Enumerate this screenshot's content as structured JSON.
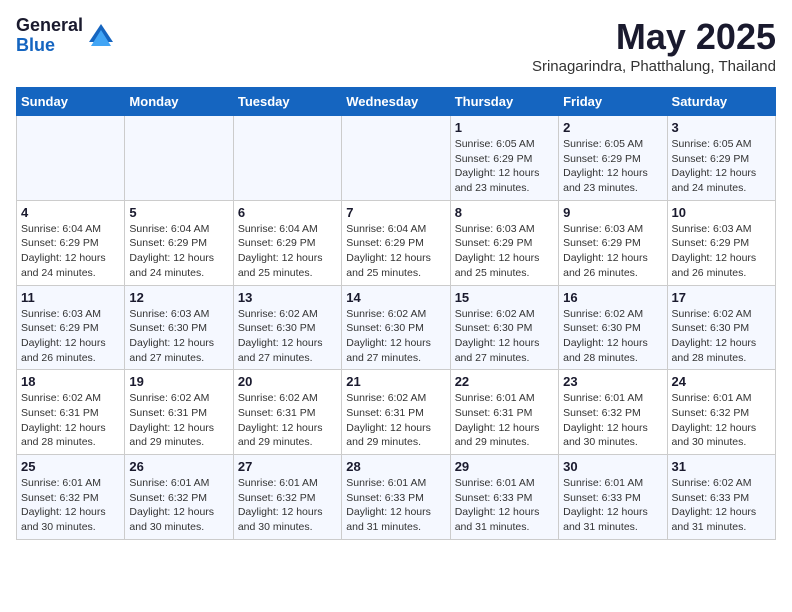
{
  "header": {
    "logo_general": "General",
    "logo_blue": "Blue",
    "title": "May 2025",
    "subtitle": "Srinagarindra, Phatthalung, Thailand"
  },
  "days_of_week": [
    "Sunday",
    "Monday",
    "Tuesday",
    "Wednesday",
    "Thursday",
    "Friday",
    "Saturday"
  ],
  "weeks": [
    [
      {
        "day": "",
        "info": ""
      },
      {
        "day": "",
        "info": ""
      },
      {
        "day": "",
        "info": ""
      },
      {
        "day": "",
        "info": ""
      },
      {
        "day": "1",
        "info": "Sunrise: 6:05 AM\nSunset: 6:29 PM\nDaylight: 12 hours\nand 23 minutes."
      },
      {
        "day": "2",
        "info": "Sunrise: 6:05 AM\nSunset: 6:29 PM\nDaylight: 12 hours\nand 23 minutes."
      },
      {
        "day": "3",
        "info": "Sunrise: 6:05 AM\nSunset: 6:29 PM\nDaylight: 12 hours\nand 24 minutes."
      }
    ],
    [
      {
        "day": "4",
        "info": "Sunrise: 6:04 AM\nSunset: 6:29 PM\nDaylight: 12 hours\nand 24 minutes."
      },
      {
        "day": "5",
        "info": "Sunrise: 6:04 AM\nSunset: 6:29 PM\nDaylight: 12 hours\nand 24 minutes."
      },
      {
        "day": "6",
        "info": "Sunrise: 6:04 AM\nSunset: 6:29 PM\nDaylight: 12 hours\nand 25 minutes."
      },
      {
        "day": "7",
        "info": "Sunrise: 6:04 AM\nSunset: 6:29 PM\nDaylight: 12 hours\nand 25 minutes."
      },
      {
        "day": "8",
        "info": "Sunrise: 6:03 AM\nSunset: 6:29 PM\nDaylight: 12 hours\nand 25 minutes."
      },
      {
        "day": "9",
        "info": "Sunrise: 6:03 AM\nSunset: 6:29 PM\nDaylight: 12 hours\nand 26 minutes."
      },
      {
        "day": "10",
        "info": "Sunrise: 6:03 AM\nSunset: 6:29 PM\nDaylight: 12 hours\nand 26 minutes."
      }
    ],
    [
      {
        "day": "11",
        "info": "Sunrise: 6:03 AM\nSunset: 6:29 PM\nDaylight: 12 hours\nand 26 minutes."
      },
      {
        "day": "12",
        "info": "Sunrise: 6:03 AM\nSunset: 6:30 PM\nDaylight: 12 hours\nand 27 minutes."
      },
      {
        "day": "13",
        "info": "Sunrise: 6:02 AM\nSunset: 6:30 PM\nDaylight: 12 hours\nand 27 minutes."
      },
      {
        "day": "14",
        "info": "Sunrise: 6:02 AM\nSunset: 6:30 PM\nDaylight: 12 hours\nand 27 minutes."
      },
      {
        "day": "15",
        "info": "Sunrise: 6:02 AM\nSunset: 6:30 PM\nDaylight: 12 hours\nand 27 minutes."
      },
      {
        "day": "16",
        "info": "Sunrise: 6:02 AM\nSunset: 6:30 PM\nDaylight: 12 hours\nand 28 minutes."
      },
      {
        "day": "17",
        "info": "Sunrise: 6:02 AM\nSunset: 6:30 PM\nDaylight: 12 hours\nand 28 minutes."
      }
    ],
    [
      {
        "day": "18",
        "info": "Sunrise: 6:02 AM\nSunset: 6:31 PM\nDaylight: 12 hours\nand 28 minutes."
      },
      {
        "day": "19",
        "info": "Sunrise: 6:02 AM\nSunset: 6:31 PM\nDaylight: 12 hours\nand 29 minutes."
      },
      {
        "day": "20",
        "info": "Sunrise: 6:02 AM\nSunset: 6:31 PM\nDaylight: 12 hours\nand 29 minutes."
      },
      {
        "day": "21",
        "info": "Sunrise: 6:02 AM\nSunset: 6:31 PM\nDaylight: 12 hours\nand 29 minutes."
      },
      {
        "day": "22",
        "info": "Sunrise: 6:01 AM\nSunset: 6:31 PM\nDaylight: 12 hours\nand 29 minutes."
      },
      {
        "day": "23",
        "info": "Sunrise: 6:01 AM\nSunset: 6:32 PM\nDaylight: 12 hours\nand 30 minutes."
      },
      {
        "day": "24",
        "info": "Sunrise: 6:01 AM\nSunset: 6:32 PM\nDaylight: 12 hours\nand 30 minutes."
      }
    ],
    [
      {
        "day": "25",
        "info": "Sunrise: 6:01 AM\nSunset: 6:32 PM\nDaylight: 12 hours\nand 30 minutes."
      },
      {
        "day": "26",
        "info": "Sunrise: 6:01 AM\nSunset: 6:32 PM\nDaylight: 12 hours\nand 30 minutes."
      },
      {
        "day": "27",
        "info": "Sunrise: 6:01 AM\nSunset: 6:32 PM\nDaylight: 12 hours\nand 30 minutes."
      },
      {
        "day": "28",
        "info": "Sunrise: 6:01 AM\nSunset: 6:33 PM\nDaylight: 12 hours\nand 31 minutes."
      },
      {
        "day": "29",
        "info": "Sunrise: 6:01 AM\nSunset: 6:33 PM\nDaylight: 12 hours\nand 31 minutes."
      },
      {
        "day": "30",
        "info": "Sunrise: 6:01 AM\nSunset: 6:33 PM\nDaylight: 12 hours\nand 31 minutes."
      },
      {
        "day": "31",
        "info": "Sunrise: 6:02 AM\nSunset: 6:33 PM\nDaylight: 12 hours\nand 31 minutes."
      }
    ]
  ]
}
